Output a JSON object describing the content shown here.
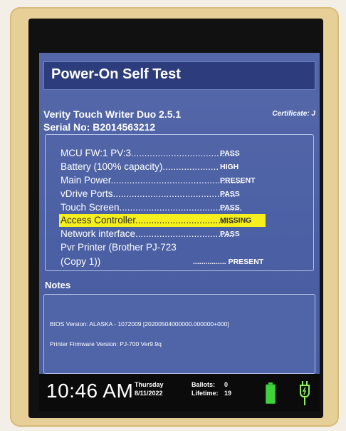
{
  "post": {
    "title": "Power-On Self Test",
    "device_name": "Verity Touch Writer Duo 2.5.1",
    "serial": "Serial No: B2014563212",
    "certificate": "Certificate: J"
  },
  "tests": [
    {
      "label": "MCU  FW:1 PV:3........................................",
      "result": "PASS"
    },
    {
      "label": "Battery  (100% capacity).....................",
      "result": "HIGH"
    },
    {
      "label": "Main Power..................................................",
      "result": "PRESENT"
    },
    {
      "label": "vDrive Ports..............................................",
      "result": "PASS"
    },
    {
      "label": "Touch Screen..............................................",
      "result": "PASS"
    },
    {
      "label": "Access Controller.....................................",
      "result": "MISSING"
    },
    {
      "label": "Network interface.....................................",
      "result": "PASS"
    },
    {
      "label": "Pvr Printer  (Brother PJ-723",
      "result": ""
    },
    {
      "label": "(Copy 1))",
      "result": "................ PRESENT"
    }
  ],
  "notes": {
    "title": "Notes",
    "bios": "BIOS Version: ALASKA - 1072009 [20200504000000.000000+000]",
    "printer_fw": "Printer Firmware Version: PJ-700 Ver9.9q"
  },
  "status": {
    "time": "10:46 AM",
    "day": "Thursday",
    "date": "8/11/2022",
    "ballots_label": "Ballots:",
    "ballots_value": "0",
    "lifetime_label": "Lifetime:",
    "lifetime_value": "19",
    "battery_icon": "battery-full-icon",
    "plug_icon": "power-plug-icon"
  },
  "colors": {
    "screen_bg": "#4d62a6",
    "title_bar": "#2d3c7c",
    "highlight": "#f4ef1d",
    "battery": "#3fd23a",
    "plug": "#8ff25a"
  }
}
